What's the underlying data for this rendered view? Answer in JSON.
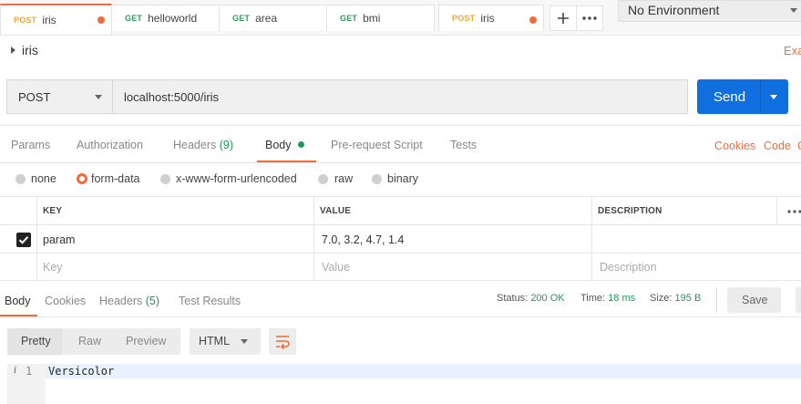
{
  "tabs": [
    {
      "method": "POST",
      "name": "iris",
      "method_color": "#f4a62a",
      "active": true,
      "unsaved": true
    },
    {
      "method": "GET",
      "name": "helloworld",
      "method_color": "#2c9b5e"
    },
    {
      "method": "GET",
      "name": "area",
      "method_color": "#2c9b5e"
    },
    {
      "method": "GET",
      "name": "bmi",
      "method_color": "#2c9b5e"
    },
    {
      "method": "POST",
      "name": "iris",
      "method_color": "#f4a62a",
      "unsaved": true
    }
  ],
  "tab_actions": {
    "add_icon": "plus-icon",
    "more_icon": "more-horizontal-icon"
  },
  "environment": {
    "selected": "No Environment"
  },
  "request": {
    "name": "iris",
    "examples_link": "Exa",
    "method": "POST",
    "url": "localhost:5000/iris",
    "send_label": "Send"
  },
  "request_tabs": {
    "params": "Params",
    "authorization": "Authorization",
    "headers": "Headers",
    "headers_count": "(9)",
    "body": "Body",
    "prerequest": "Pre-request Script",
    "tests": "Tests",
    "cookies": "Cookies",
    "code": "Code",
    "extra": "C"
  },
  "body_types": {
    "none": "none",
    "form_data": "form-data",
    "urlencoded": "x-www-form-urlencoded",
    "raw": "raw",
    "binary": "binary",
    "selected": "form-data"
  },
  "form_table": {
    "headers": {
      "key": "KEY",
      "value": "VALUE",
      "description": "DESCRIPTION"
    },
    "rows": [
      {
        "checked": true,
        "key": "param",
        "value": "7.0,  3.2, 4.7, 1.4",
        "description": ""
      }
    ],
    "placeholders": {
      "key": "Key",
      "value": "Value",
      "description": "Description"
    }
  },
  "response_tabs": {
    "body": "Body",
    "cookies": "Cookies",
    "headers": "Headers",
    "headers_count": "(5)",
    "test_results": "Test Results"
  },
  "response_status": {
    "status_label": "Status:",
    "status_value": "200 OK",
    "time_label": "Time:",
    "time_value": "18 ms",
    "size_label": "Size:",
    "size_value": "195 B",
    "save_label": "Save"
  },
  "response_format": {
    "pretty": "Pretty",
    "raw": "Raw",
    "preview": "Preview",
    "language": "HTML",
    "wrap_icon": "wrap-lines-icon"
  },
  "response_body": {
    "lines": [
      {
        "number": "1",
        "text": "Versicolor"
      }
    ]
  },
  "colors": {
    "accent": "#f26b3a",
    "send": "#0f6fde",
    "success": "#1f9a5a"
  }
}
